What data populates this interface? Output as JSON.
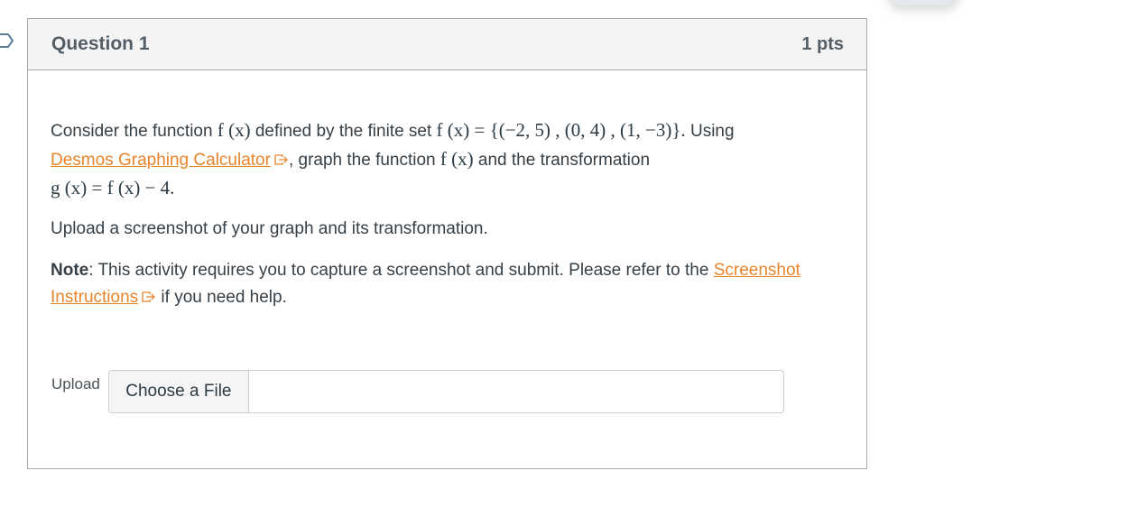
{
  "question": {
    "title": "Question 1",
    "points": "1 pts",
    "intro_text": "Consider the function ",
    "fx": "f (x)",
    "defined_text": " defined by the finite set ",
    "set_expr": "f (x) = {(−2, 5) , (0, 4) , (1, −3)}.",
    "using_text": " Using",
    "desmos_link": "Desmos Graphing Calculator",
    "graph_text": ", graph the function ",
    "fx2": "f (x)",
    "and_text": " and the transformation",
    "gx_expr": "g (x) = f (x) − 4.",
    "upload_instruction": "Upload a screenshot of your graph and its transformation.",
    "note_label": "Note",
    "note_text": ": This activity requires you to capture a screenshot and submit. Please refer to the ",
    "screenshot_link": "Screenshot Instructions",
    "help_text": " if you need help."
  },
  "upload": {
    "label": "Upload",
    "button_label": "Choose a File",
    "file_value": ""
  },
  "icons": {
    "external_link": "external-link-icon",
    "bookmark": "bookmark-flag-icon"
  },
  "colors": {
    "link": "#e8842c",
    "header_bg": "#f4f4f4",
    "text": "#363f46"
  }
}
